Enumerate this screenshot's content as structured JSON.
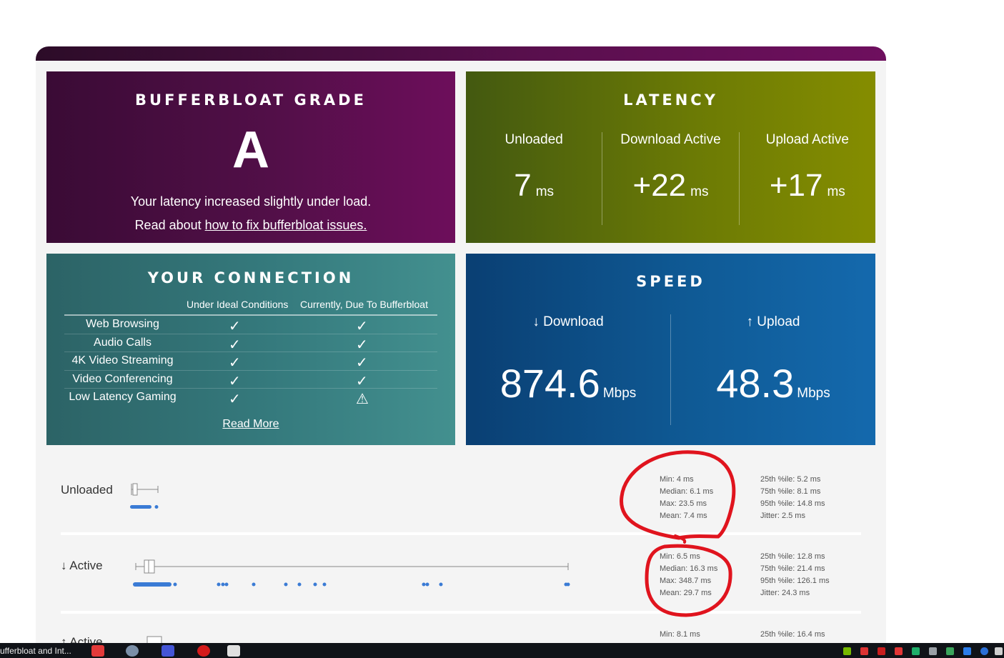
{
  "grade": {
    "title": "BUFFERBLOAT GRADE",
    "letter": "A",
    "line1": "Your latency increased slightly under load.",
    "line2_prefix": "Read about ",
    "line2_link": "how to fix bufferbloat issues."
  },
  "latency": {
    "title": "LATENCY",
    "columns": [
      {
        "label": "Unloaded",
        "value": "7",
        "unit": "ms"
      },
      {
        "label": "Download Active",
        "value": "+22",
        "unit": "ms"
      },
      {
        "label": "Upload Active",
        "value": "+17",
        "unit": "ms"
      }
    ]
  },
  "connection": {
    "title": "YOUR CONNECTION",
    "col_ideal": "Under Ideal Conditions",
    "col_current": "Currently, Due To Bufferbloat",
    "rows": [
      {
        "name": "Web Browsing",
        "ideal": "✓",
        "current": "✓"
      },
      {
        "name": "Audio Calls",
        "ideal": "✓",
        "current": "✓"
      },
      {
        "name": "4K Video Streaming",
        "ideal": "✓",
        "current": "✓"
      },
      {
        "name": "Video Conferencing",
        "ideal": "✓",
        "current": "✓"
      },
      {
        "name": "Low Latency Gaming",
        "ideal": "✓",
        "current": "⚠"
      }
    ],
    "read_more": "Read More"
  },
  "speed": {
    "title": "SPEED",
    "download": {
      "label": "↓ Download",
      "value": "874.6",
      "unit": "Mbps"
    },
    "upload": {
      "label": "↑ Upload",
      "value": "48.3",
      "unit": "Mbps"
    }
  },
  "results": {
    "unloaded": {
      "label": "Unloaded",
      "stats_left": [
        "Min: 4 ms",
        "Median: 6.1 ms",
        "Max: 23.5 ms",
        "Mean: 7.4 ms"
      ],
      "stats_right": [
        "25th %ile: 5.2 ms",
        "75th %ile: 8.1 ms",
        "95th %ile: 14.8 ms",
        "Jitter: 2.5 ms"
      ]
    },
    "download_active": {
      "label": "↓ Active",
      "stats_left": [
        "Min: 6.5 ms",
        "Median: 16.3 ms",
        "Max: 348.7 ms",
        "Mean: 29.7 ms"
      ],
      "stats_right": [
        "25th %ile: 12.8 ms",
        "75th %ile: 21.4 ms",
        "95th %ile: 126.1 ms",
        "Jitter: 24.3 ms"
      ]
    },
    "upload_active": {
      "label": "↑ Active",
      "stats_left": [
        "Min: 8.1 ms"
      ],
      "stats_right": [
        "25th %ile: 16.4 ms"
      ]
    }
  },
  "annotation_color": "#e0141e",
  "taskbar": {
    "window_title": "ufferbloat and Int..."
  }
}
